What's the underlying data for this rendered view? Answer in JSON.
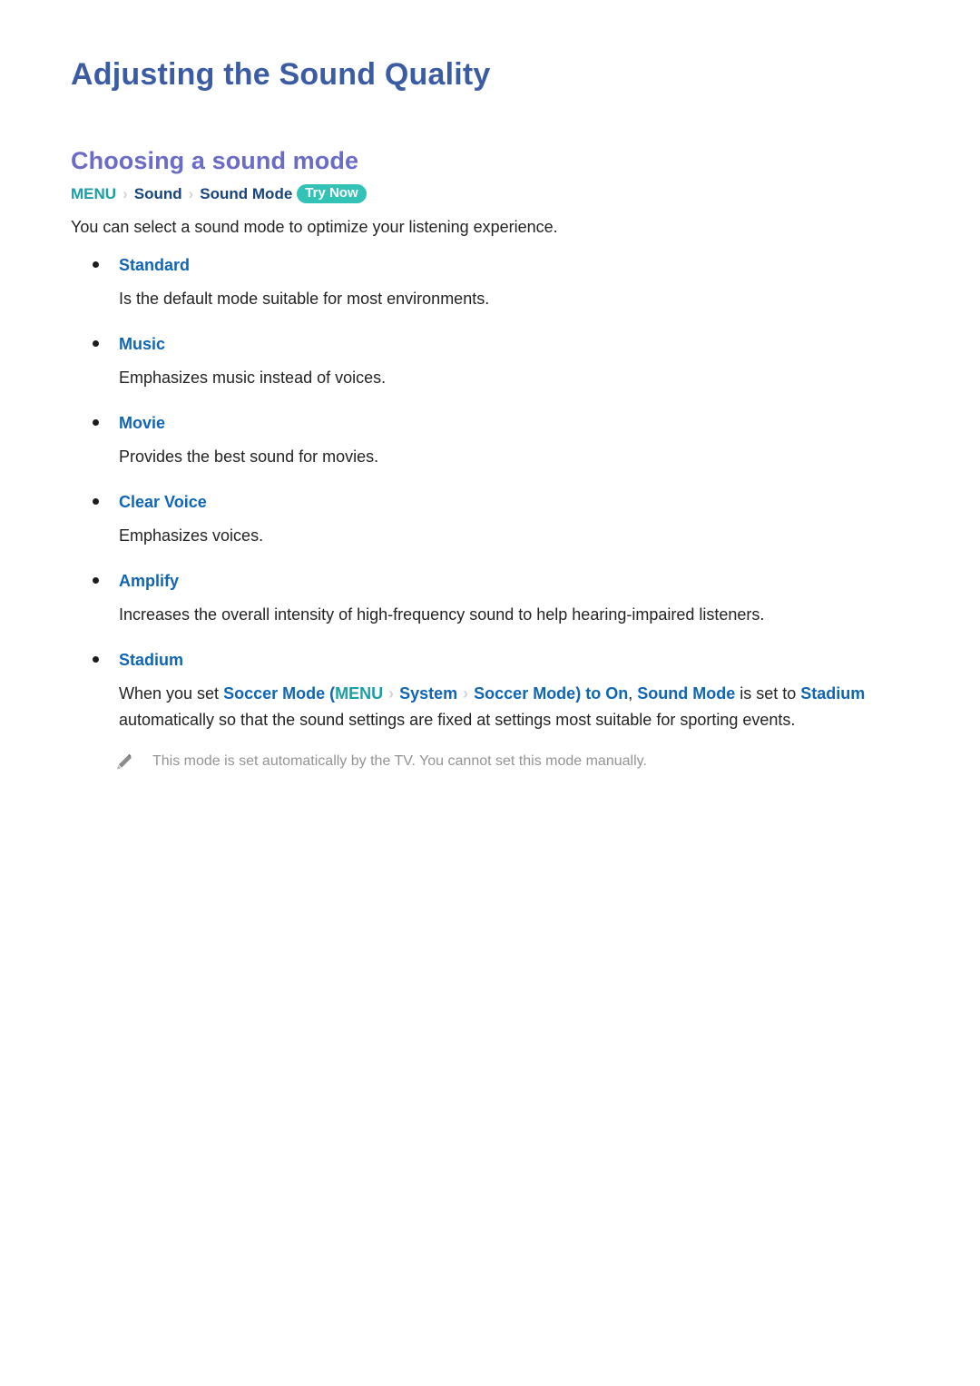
{
  "document": {
    "title": "Adjusting the Sound Quality",
    "section_title": "Choosing a sound mode"
  },
  "breadcrumb": {
    "menu_label": "MENU",
    "separator": "›",
    "items": [
      "Sound",
      "Sound Mode"
    ],
    "badge_label": "Try Now"
  },
  "intro": "You can select a sound mode to optimize your listening experience.",
  "modes": [
    {
      "label": "Standard",
      "description": "Is the default mode suitable for most environments."
    },
    {
      "label": "Music",
      "description": "Emphasizes music instead of voices."
    },
    {
      "label": "Movie",
      "description": "Provides the best sound for movies."
    },
    {
      "label": "Clear Voice",
      "description": "Emphasizes voices."
    },
    {
      "label": "Amplify",
      "description": "Increases the overall intensity of high-frequency sound to help hearing-impaired listeners."
    },
    {
      "label": "Stadium",
      "description_parts": {
        "p1": "When you set ",
        "k1": "Soccer Mode",
        "p2": " (",
        "k_menu": "MENU",
        "sep1": "›",
        "k_system": "System",
        "sep2": "›",
        "k_soccer": "Soccer Mode",
        "p3": ") to ",
        "k_on": "On",
        "p4": ", ",
        "k_sound_mode": "Sound Mode",
        "p5": " is set to ",
        "k_stadium": "Stadium",
        "p6": " automatically so that the sound settings are fixed at settings most suitable for sporting events."
      }
    }
  ],
  "note": {
    "icon": "pencil-icon",
    "text": "This mode is set automatically by the TV. You cannot set this mode manually."
  },
  "colors": {
    "page_title": "#3B5BA3",
    "section_title": "#6A6CC6",
    "keyword_blue": "#1065B5",
    "keyword_teal": "#1C9FA4",
    "badge_teal": "#33C2B6",
    "body_text": "#232323",
    "note_text": "#949494",
    "separator_gray": "#D2D2D2"
  }
}
